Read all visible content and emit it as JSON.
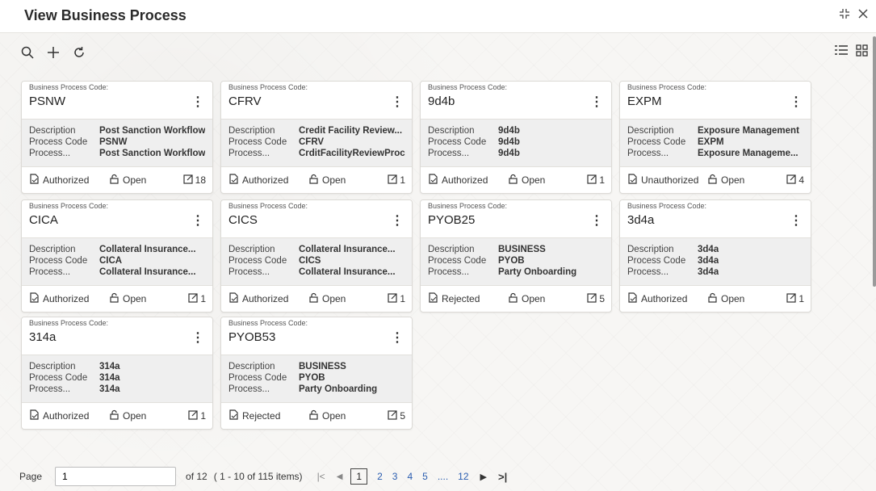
{
  "header": {
    "title": "View Business Process"
  },
  "cards": [
    {
      "code_label": "Business Process Code:",
      "code": "PSNW",
      "description": "Post Sanction Workflow",
      "process_code": "PSNW",
      "process": "Post Sanction Workflow",
      "status": "Authorized",
      "open": "Open",
      "count": "18"
    },
    {
      "code_label": "Business Process Code:",
      "code": "CFRV",
      "description": "Credit Facility Review...",
      "process_code": "CFRV",
      "process": "CrditFacilityReviewProc",
      "status": "Authorized",
      "open": "Open",
      "count": "1"
    },
    {
      "code_label": "Business Process Code:",
      "code": "9d4b",
      "description": "9d4b",
      "process_code": "9d4b",
      "process": "9d4b",
      "status": "Authorized",
      "open": "Open",
      "count": "1"
    },
    {
      "code_label": "Business Process Code:",
      "code": "EXPM",
      "description": "Exposure Management",
      "process_code": "EXPM",
      "process": "Exposure Manageme...",
      "status": "Unauthorized",
      "open": "Open",
      "count": "4"
    },
    {
      "code_label": "Business Process Code:",
      "code": "CICA",
      "description": "Collateral Insurance...",
      "process_code": "CICA",
      "process": "Collateral Insurance...",
      "status": "Authorized",
      "open": "Open",
      "count": "1"
    },
    {
      "code_label": "Business Process Code:",
      "code": "CICS",
      "description": "Collateral Insurance...",
      "process_code": "CICS",
      "process": "Collateral Insurance...",
      "status": "Authorized",
      "open": "Open",
      "count": "1"
    },
    {
      "code_label": "Business Process Code:",
      "code": "PYOB25",
      "description": "BUSINESS",
      "process_code": "PYOB",
      "process": "Party Onboarding",
      "status": "Rejected",
      "open": "Open",
      "count": "5"
    },
    {
      "code_label": "Business Process Code:",
      "code": "3d4a",
      "description": "3d4a",
      "process_code": "3d4a",
      "process": "3d4a",
      "status": "Authorized",
      "open": "Open",
      "count": "1"
    },
    {
      "code_label": "Business Process Code:",
      "code": "314a",
      "description": "314a",
      "process_code": "314a",
      "process": "314a",
      "status": "Authorized",
      "open": "Open",
      "count": "1"
    },
    {
      "code_label": "Business Process Code:",
      "code": "PYOB53",
      "description": "BUSINESS",
      "process_code": "PYOB",
      "process": "Party Onboarding",
      "status": "Rejected",
      "open": "Open",
      "count": "5"
    }
  ],
  "labels": {
    "description": "Description",
    "process_code": "Process Code",
    "process": "Process..."
  },
  "pagination": {
    "page_label": "Page",
    "page_value": "1",
    "of_label": "of 12",
    "items_label": "( 1 - 10 of 115 items)",
    "current": "1",
    "pages": [
      "2",
      "3",
      "4",
      "5"
    ],
    "ellipsis": "....",
    "last": "12"
  }
}
